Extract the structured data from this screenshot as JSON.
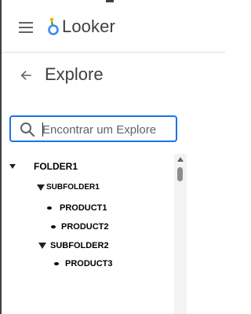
{
  "app": {
    "name": "Looker"
  },
  "page": {
    "title": "Explore"
  },
  "search": {
    "placeholder": "Encontrar um Explore",
    "value": ""
  },
  "tree": {
    "items": [
      {
        "label": "FOLDER1",
        "kind": "folder",
        "expanded": true
      },
      {
        "label": "SUBFOLDER1",
        "kind": "folder",
        "expanded": true
      },
      {
        "label": "PRODUCT1",
        "kind": "explore"
      },
      {
        "label": "PRODUCT2",
        "kind": "explore"
      },
      {
        "label": "SUBFOLDER2",
        "kind": "folder",
        "expanded": true
      },
      {
        "label": "PRODUCT3",
        "kind": "explore"
      }
    ]
  },
  "icons": {
    "menu": "hamburger-menu-icon",
    "back": "arrow-left-icon",
    "search": "search-icon",
    "folder_open": "caret-down-icon",
    "explore": "bullet-icon"
  },
  "colors": {
    "accent": "#1a73e8",
    "logo_blue": "#4285f4",
    "logo_orange": "#f9ab00",
    "text": "#3c4043"
  }
}
